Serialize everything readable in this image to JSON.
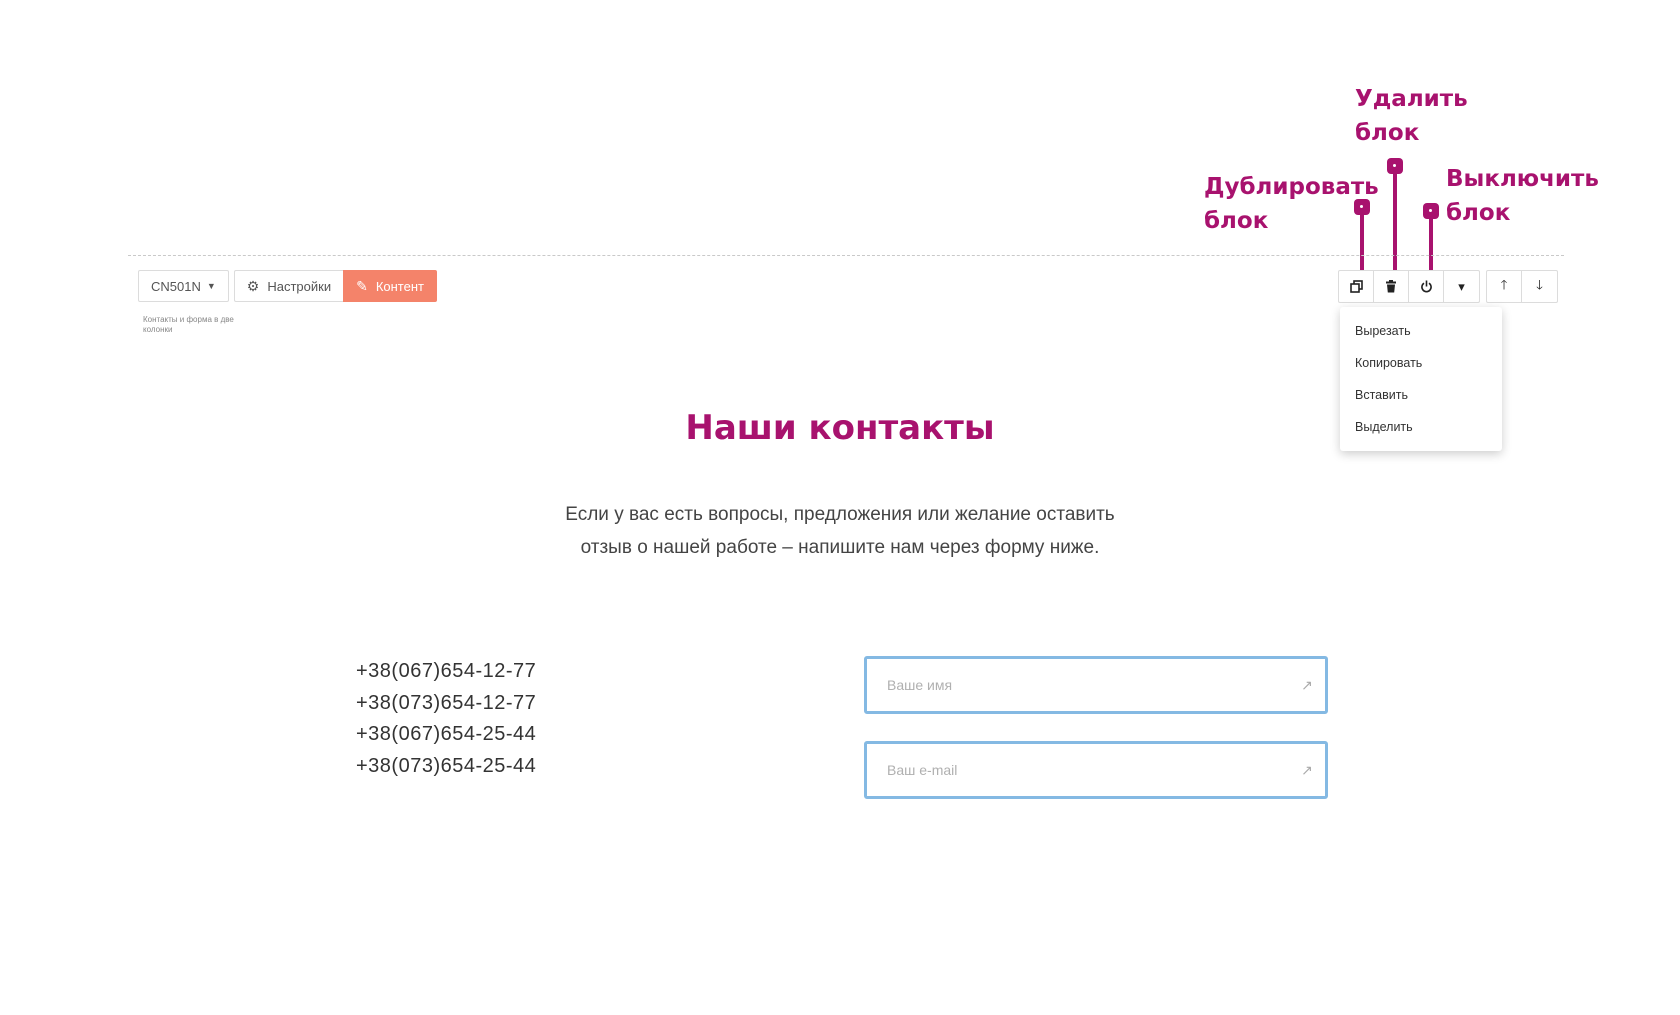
{
  "annotations": {
    "delete_block": "Удалить\nблок",
    "duplicate_block": "Дублировать\nблок",
    "disable_block": "Выключить\nблок"
  },
  "toolbar": {
    "block_code": "CN501N",
    "settings_label": "Настройки",
    "content_label": "Контент",
    "block_caption": "Контакты и форма в две колонки"
  },
  "block_actions": {
    "icons": [
      "duplicate-icon",
      "trash-icon",
      "power-icon",
      "caret-down-icon",
      "arrow-up-icon",
      "arrow-down-icon"
    ],
    "menu": [
      "Вырезать",
      "Копировать",
      "Вставить",
      "Выделить"
    ]
  },
  "content": {
    "title": "Наши контакты",
    "subtitle": "Если у вас есть вопросы, предложения или желание оставить отзыв о нашей работе – напишите нам через форму ниже.",
    "phones": [
      "+38(067)654-12-77",
      "+38(073)654-12-77",
      "+38(067)654-25-44",
      "+38(073)654-25-44"
    ],
    "form": {
      "name_placeholder": "Ваше имя",
      "email_placeholder": "Ваш e-mail"
    }
  },
  "colors": {
    "accent": "#a8126e",
    "content_button": "#f4836a",
    "field_border": "#84b9e3"
  }
}
